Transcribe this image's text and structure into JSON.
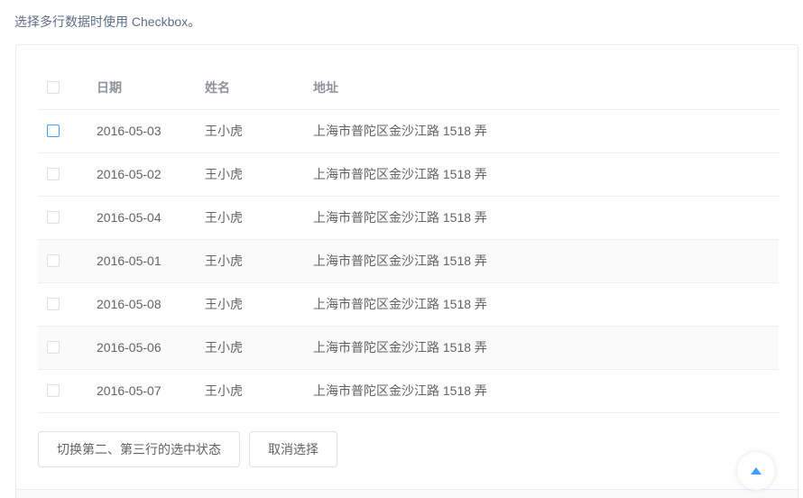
{
  "description": "选择多行数据时使用 Checkbox。",
  "table": {
    "headers": {
      "date": "日期",
      "name": "姓名",
      "address": "地址"
    },
    "rows": [
      {
        "date": "2016-05-03",
        "name": "王小虎",
        "address": "上海市普陀区金沙江路 1518 弄"
      },
      {
        "date": "2016-05-02",
        "name": "王小虎",
        "address": "上海市普陀区金沙江路 1518 弄"
      },
      {
        "date": "2016-05-04",
        "name": "王小虎",
        "address": "上海市普陀区金沙江路 1518 弄"
      },
      {
        "date": "2016-05-01",
        "name": "王小虎",
        "address": "上海市普陀区金沙江路 1518 弄"
      },
      {
        "date": "2016-05-08",
        "name": "王小虎",
        "address": "上海市普陀区金沙江路 1518 弄"
      },
      {
        "date": "2016-05-06",
        "name": "王小虎",
        "address": "上海市普陀区金沙江路 1518 弄"
      },
      {
        "date": "2016-05-07",
        "name": "王小虎",
        "address": "上海市普陀区金沙江路 1518 弄"
      }
    ]
  },
  "actions": {
    "toggle_label": "切换第二、第三行的选中状态",
    "clear_label": "取消选择"
  },
  "backtop_icon": "caret-up-icon",
  "colors": {
    "accent": "#409eff",
    "header_text": "#909399",
    "body_text": "#606266",
    "border": "#ebeef5"
  }
}
